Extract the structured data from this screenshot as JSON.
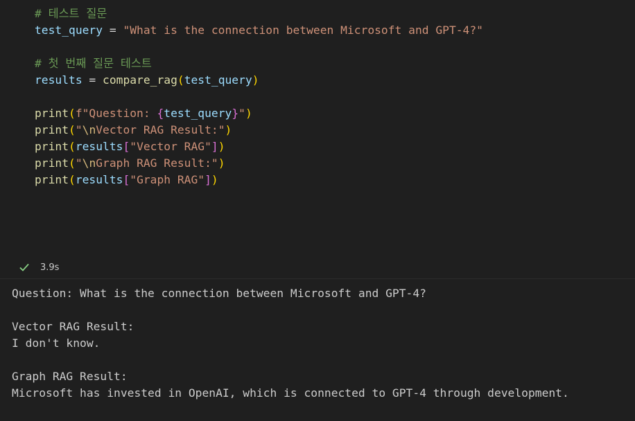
{
  "cell": {
    "code_lines": [
      [
        {
          "t": "# 테스트 질문",
          "c": "comment"
        }
      ],
      [
        {
          "t": "test_query",
          "c": "var"
        },
        {
          "t": " = ",
          "c": "op"
        },
        {
          "t": "\"What is the connection between Microsoft and GPT-4?\"",
          "c": "str"
        }
      ],
      [],
      [
        {
          "t": "# 첫 번째 질문 테스트",
          "c": "comment"
        }
      ],
      [
        {
          "t": "results",
          "c": "var"
        },
        {
          "t": " = ",
          "c": "op"
        },
        {
          "t": "compare_rag",
          "c": "fn"
        },
        {
          "t": "(",
          "c": "p1"
        },
        {
          "t": "test_query",
          "c": "var"
        },
        {
          "t": ")",
          "c": "p1"
        }
      ],
      [],
      [
        {
          "t": "print",
          "c": "fn"
        },
        {
          "t": "(",
          "c": "p1"
        },
        {
          "t": "f\"Question: ",
          "c": "str"
        },
        {
          "t": "{",
          "c": "p2"
        },
        {
          "t": "test_query",
          "c": "var"
        },
        {
          "t": "}",
          "c": "p2"
        },
        {
          "t": "\"",
          "c": "str"
        },
        {
          "t": ")",
          "c": "p1"
        }
      ],
      [
        {
          "t": "print",
          "c": "fn"
        },
        {
          "t": "(",
          "c": "p1"
        },
        {
          "t": "\"",
          "c": "str"
        },
        {
          "t": "\\n",
          "c": "esc"
        },
        {
          "t": "Vector RAG Result:\"",
          "c": "str"
        },
        {
          "t": ")",
          "c": "p1"
        }
      ],
      [
        {
          "t": "print",
          "c": "fn"
        },
        {
          "t": "(",
          "c": "p1"
        },
        {
          "t": "results",
          "c": "var"
        },
        {
          "t": "[",
          "c": "p2"
        },
        {
          "t": "\"Vector RAG\"",
          "c": "str"
        },
        {
          "t": "]",
          "c": "p2"
        },
        {
          "t": ")",
          "c": "p1"
        }
      ],
      [
        {
          "t": "print",
          "c": "fn"
        },
        {
          "t": "(",
          "c": "p1"
        },
        {
          "t": "\"",
          "c": "str"
        },
        {
          "t": "\\n",
          "c": "esc"
        },
        {
          "t": "Graph RAG Result:\"",
          "c": "str"
        },
        {
          "t": ")",
          "c": "p1"
        }
      ],
      [
        {
          "t": "print",
          "c": "fn"
        },
        {
          "t": "(",
          "c": "p1"
        },
        {
          "t": "results",
          "c": "var"
        },
        {
          "t": "[",
          "c": "p2"
        },
        {
          "t": "\"Graph RAG\"",
          "c": "str"
        },
        {
          "t": "]",
          "c": "p2"
        },
        {
          "t": ")",
          "c": "p1"
        }
      ]
    ],
    "execution_time": "3.9s",
    "status_icon": "check-icon",
    "success_color": "#89d185"
  },
  "output": {
    "lines": [
      "Question: What is the connection between Microsoft and GPT-4?",
      "",
      "Vector RAG Result:",
      "I don't know.",
      "",
      "Graph RAG Result:",
      "Microsoft has invested in OpenAI, which is connected to GPT-4 through development."
    ]
  },
  "colors": {
    "background": "#1f1f1f",
    "comment": "#6a9955",
    "variable": "#9cdcfe",
    "string": "#ce9178",
    "function": "#dcdcaa"
  }
}
